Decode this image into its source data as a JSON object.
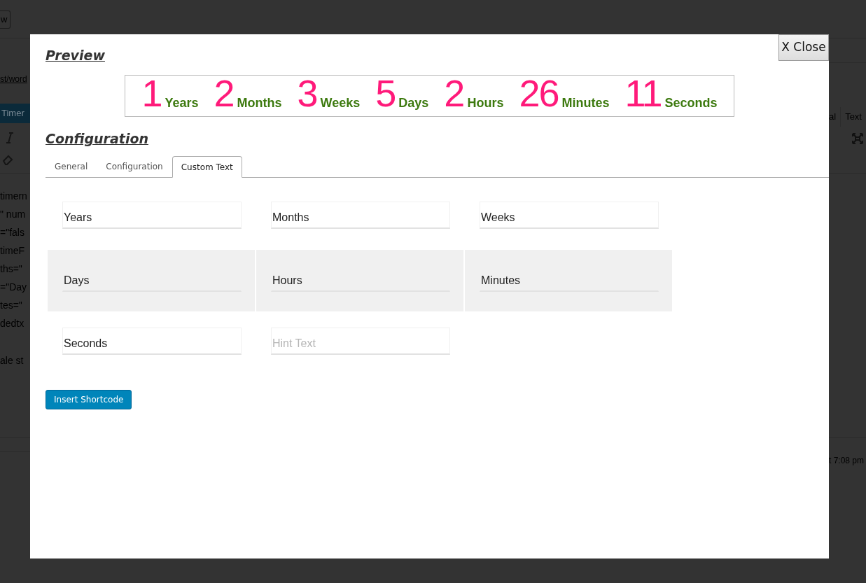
{
  "background": {
    "view_button": "w",
    "link": "st/word",
    "tab": "Timer",
    "code_lines": [
      "timern",
      "\" num",
      "=\"fals",
      "timeF",
      "ths=\"",
      "=\"Day",
      "tes=\"",
      "dedtx"
    ],
    "status_text": "ale st",
    "editor_tabs": [
      {
        "label": "al"
      },
      {
        "label": "Text"
      }
    ],
    "timestamp": "t 7:08 pm"
  },
  "modal": {
    "close_button": "X Close",
    "preview_title": "Preview",
    "countdown": [
      {
        "number": "1",
        "unit": "Years"
      },
      {
        "number": "2",
        "unit": "Months"
      },
      {
        "number": "3",
        "unit": "Weeks"
      },
      {
        "number": "5",
        "unit": "Days"
      },
      {
        "number": "2",
        "unit": "Hours"
      },
      {
        "number": "26",
        "unit": "Minutes"
      },
      {
        "number": "11",
        "unit": "Seconds"
      }
    ],
    "configuration_title": "Configuration",
    "tabs": [
      {
        "label": "General",
        "selected": false
      },
      {
        "label": "Configuration",
        "selected": false
      },
      {
        "label": "Custom Text",
        "selected": true
      }
    ],
    "fields": [
      {
        "value": "Years",
        "highlighted": false
      },
      {
        "value": "Months",
        "highlighted": false
      },
      {
        "value": "Weeks",
        "highlighted": false
      },
      {
        "value": "Days",
        "highlighted": true
      },
      {
        "value": "Hours",
        "highlighted": true
      },
      {
        "value": "Minutes",
        "highlighted": true
      },
      {
        "value": "Seconds",
        "highlighted": false
      },
      {
        "placeholder": "Hint Text",
        "highlighted": false
      }
    ],
    "insert_button": "Insert Shortcode"
  }
}
